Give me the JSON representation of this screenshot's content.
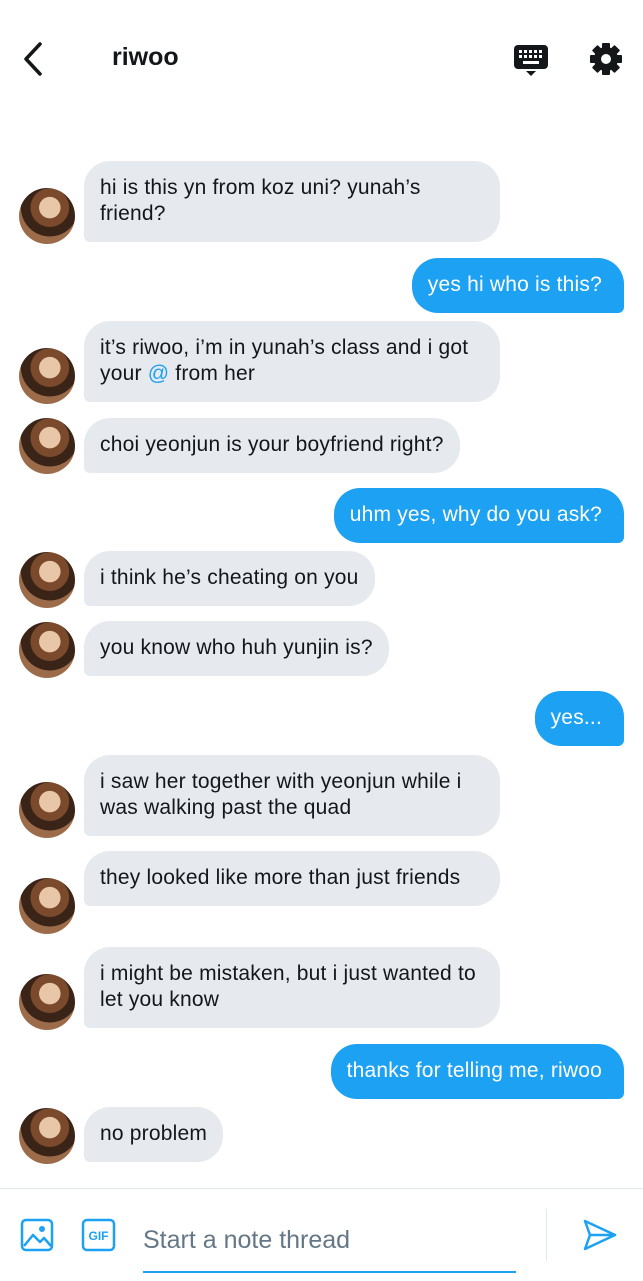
{
  "header": {
    "title": "riwoo",
    "back_icon": "back-arrow-icon",
    "keyboard_icon": "keyboard-icon",
    "settings_icon": "gear-icon"
  },
  "messages": [
    {
      "side": "in",
      "text": "hi is this yn from koz uni? yunah’s friend?"
    },
    {
      "side": "out",
      "text": "yes hi who is this?"
    },
    {
      "side": "in",
      "text_before": "it’s riwoo, i’m in yunah’s class and i got your",
      "mention": "@",
      "text_after": "from her"
    },
    {
      "side": "in",
      "text": "choi yeonjun is your boyfriend right?"
    },
    {
      "side": "out",
      "text": "uhm yes, why do you ask?"
    },
    {
      "side": "in",
      "text": "i think he’s cheating on you"
    },
    {
      "side": "in",
      "text": "you know who huh yunjin is?"
    },
    {
      "side": "out",
      "text": "yes..."
    },
    {
      "side": "in",
      "text": "i saw her together with yeonjun while i was walking past the quad"
    },
    {
      "side": "in",
      "text": "they looked like more than just friends"
    },
    {
      "side": "in",
      "text": "i might be mistaken, but i just wanted to let you know"
    },
    {
      "side": "out",
      "text": "thanks for telling me, riwoo"
    },
    {
      "side": "in",
      "text": "no problem"
    }
  ],
  "composer": {
    "placeholder": "Start a note thread",
    "gif_label": "GIF",
    "image_icon": "image-icon",
    "send_icon": "send-icon"
  },
  "colors": {
    "accent": "#1da1f2",
    "incoming_bubble": "#e6e9ed",
    "text": "#14171a",
    "placeholder": "#657786"
  }
}
